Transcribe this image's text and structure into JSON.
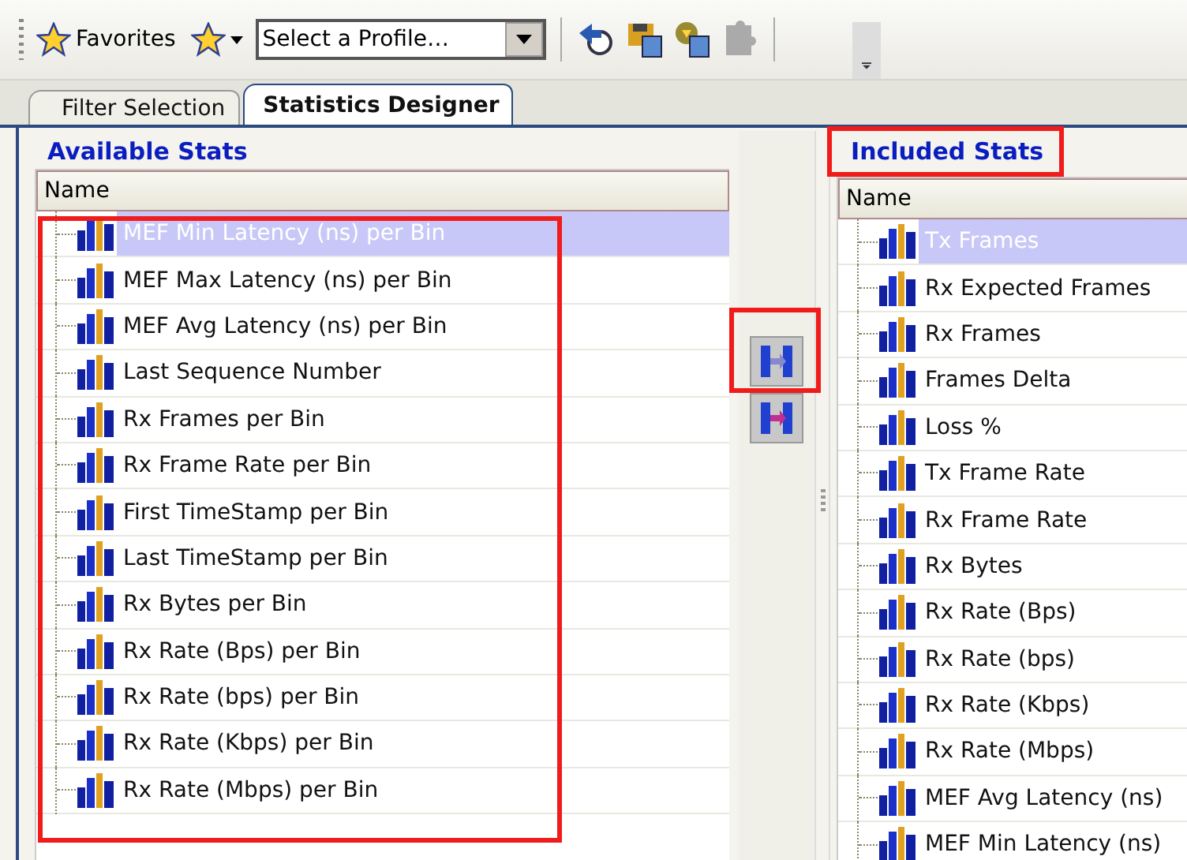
{
  "toolbar": {
    "favorites": "Favorites",
    "profile_select": {
      "value": "Select a Profile…"
    },
    "tools": [
      {
        "kind": "refresh",
        "disabled": false
      },
      {
        "kind": "save",
        "disabled": false
      },
      {
        "kind": "load",
        "disabled": false
      },
      {
        "kind": "puzzle",
        "disabled": true
      }
    ]
  },
  "tabs": [
    {
      "label": "Filter Selection",
      "selected": false
    },
    {
      "label": "Statistics Designer",
      "selected": true
    }
  ],
  "available": {
    "title": "Available Stats",
    "column": "Name",
    "items": [
      {
        "label": "MEF Min Latency (ns) per Bin",
        "selected": true
      },
      {
        "label": "MEF Max Latency (ns) per Bin",
        "selected": false
      },
      {
        "label": "MEF Avg Latency (ns) per Bin",
        "selected": false
      },
      {
        "label": "Last Sequence Number",
        "selected": false
      },
      {
        "label": "Rx Frames per Bin",
        "selected": false
      },
      {
        "label": "Rx Frame Rate per Bin",
        "selected": false
      },
      {
        "label": "First TimeStamp per Bin",
        "selected": false
      },
      {
        "label": "Last TimeStamp per Bin",
        "selected": false
      },
      {
        "label": "Rx Bytes per Bin",
        "selected": false
      },
      {
        "label": "Rx Rate (Bps) per Bin",
        "selected": false
      },
      {
        "label": "Rx Rate (bps) per Bin",
        "selected": false
      },
      {
        "label": "Rx Rate (Kbps) per Bin",
        "selected": false
      },
      {
        "label": "Rx Rate (Mbps) per Bin",
        "selected": false
      }
    ]
  },
  "included": {
    "title": "Included Stats",
    "column": "Name",
    "items": [
      {
        "label": "Tx Frames",
        "selected": true
      },
      {
        "label": "Rx Expected Frames",
        "selected": false
      },
      {
        "label": "Rx Frames",
        "selected": false
      },
      {
        "label": "Frames Delta",
        "selected": false
      },
      {
        "label": "Loss %",
        "selected": false
      },
      {
        "label": "Tx Frame Rate",
        "selected": false
      },
      {
        "label": "Rx Frame Rate",
        "selected": false
      },
      {
        "label": "Rx Bytes",
        "selected": false
      },
      {
        "label": "Rx Rate (Bps)",
        "selected": false
      },
      {
        "label": "Rx Rate (bps)",
        "selected": false
      },
      {
        "label": "Rx Rate (Kbps)",
        "selected": false
      },
      {
        "label": "Rx Rate (Mbps)",
        "selected": false
      },
      {
        "label": "MEF Avg Latency (ns)",
        "selected": false
      },
      {
        "label": "MEF Min Latency (ns)",
        "selected": false
      }
    ]
  }
}
